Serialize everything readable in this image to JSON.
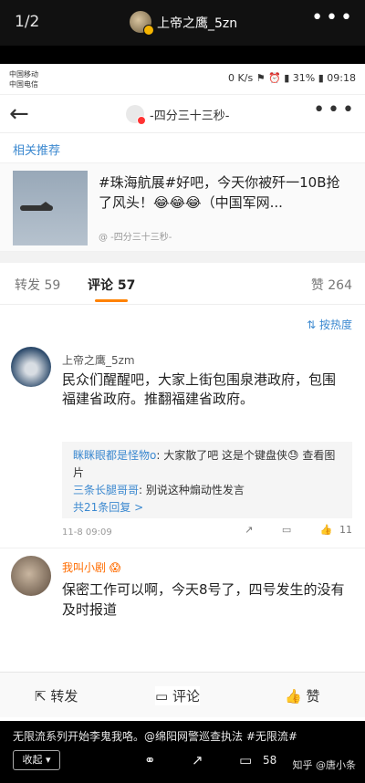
{
  "viewer": {
    "page_index": "1/2",
    "user_name": "上帝之鹰_5zn",
    "more_icon": "more-dots-icon"
  },
  "status_bar": {
    "carrier1": "中国移动",
    "carrier2": "中国电信",
    "right": "0 K/s ⚑ ⏰ ▮ 31% ▮ 09:18"
  },
  "navbar": {
    "title": "-四分三十三秒-"
  },
  "related": {
    "label": "相关推荐",
    "text": "#珠海航展#好吧，今天你被歼一10B抢了风头！😂😂😂（中国军网...",
    "source": "@ -四分三十三秒-"
  },
  "tabs": {
    "repost": "转发 59",
    "comment": "评论 57",
    "like": "赞 264"
  },
  "sort": "按热度",
  "comment1": {
    "name": "上帝之鹰_5zm",
    "text": "民众们醒醒吧，大家上街包围泉港政府，包围福建省政府。推翻福建省政府。",
    "reply1_name": "眯眯眼都是怪物o",
    "reply1_text": ": 大家散了吧 这是个键盘侠😓 查看图片",
    "reply2_name": "三条长腿哥哥",
    "reply2_text": ": 别说这种煽动性发言",
    "more_replies": "共21条回复 >",
    "time": "11-8 09:09",
    "likes": "11"
  },
  "comment2": {
    "name": "我叫小剧 😱",
    "text": "保密工作可以啊，今天8号了，四号发生的没有及时报道"
  },
  "actionbar": {
    "repost": "转发",
    "comment": "评论",
    "like": "赞"
  },
  "bottom": {
    "caption": "无限流系列开始李鬼我咯。@绵阳网警巡查执法 #无限流#",
    "collapse": "收起",
    "comments_count": "58",
    "watermark": "知乎 @唐小条"
  }
}
